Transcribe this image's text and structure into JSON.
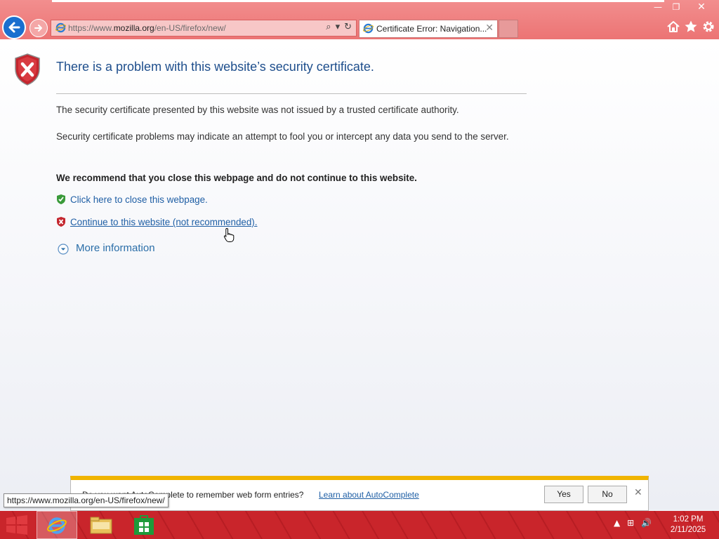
{
  "window": {
    "minimize_glyph": "—",
    "restore_glyph": "❐",
    "close_glyph": "✕"
  },
  "address_bar": {
    "url_prefix": "https://www.",
    "url_domain": "mozilla.org",
    "url_path": "/en-US/firefox/new/",
    "search_glyph": "⌕",
    "dropdown_glyph": "▾",
    "refresh_glyph": "↻"
  },
  "tab": {
    "title": "Certificate Error: Navigation...",
    "close_glyph": "✕"
  },
  "page": {
    "title": "There is a problem with this website’s security certificate.",
    "para1": "The security certificate presented by this website was not issued by a trusted certificate authority.",
    "para2": "Security certificate problems may indicate an attempt to fool you or intercept any data you send to the server.",
    "para3": "We recommend that you close this webpage and do not continue to this website.",
    "close_link": "Click here to close this webpage.",
    "continue_link": "Continue to this website (not recommended).",
    "more_info": "More information"
  },
  "notification": {
    "text": "Do you want AutoComplete to remember web form entries?",
    "link": "Learn about AutoComplete",
    "yes": "Yes",
    "no": "No",
    "close_glyph": "✕"
  },
  "status_tip": "https://www.mozilla.org/en-US/firefox/new/",
  "taskbar": {
    "time": "1:02 PM",
    "date": "2/11/2025",
    "tray_up": "▲",
    "tray_network": "⊞",
    "tray_volume": "🔊"
  },
  "colors": {
    "chrome": "#ec7474",
    "taskbar": "#c9252b",
    "link": "#1f5fa5",
    "title": "#1e4e8c",
    "notify_accent": "#f0b400"
  },
  "icons": [
    "back-arrow-icon",
    "forward-arrow-icon",
    "ie-icon",
    "home-icon",
    "favorites-star-icon",
    "gear-icon",
    "shield-error-icon",
    "shield-ok-icon",
    "expand-chevron-icon",
    "hand-cursor-icon",
    "windows-start-icon",
    "file-explorer-icon",
    "store-icon"
  ]
}
